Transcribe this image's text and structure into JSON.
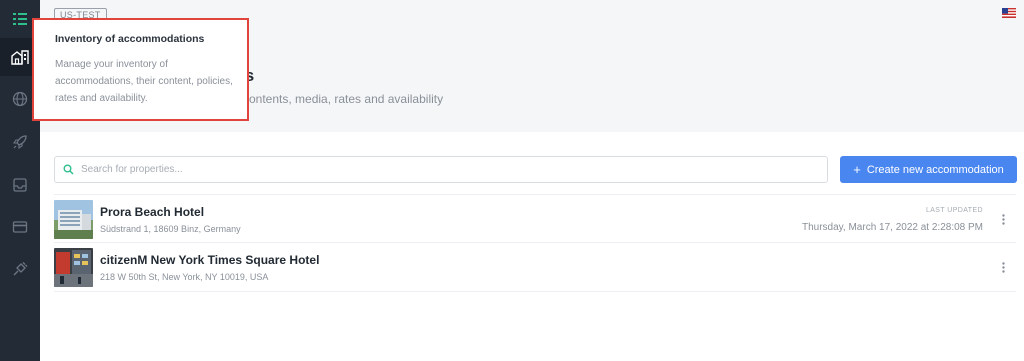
{
  "app": {
    "env_badge": "US-TEST",
    "locale_flag": "us-flag-icon"
  },
  "sidebar": {
    "items": [
      {
        "name": "menu",
        "icon": "menu-icon"
      },
      {
        "name": "accommodations",
        "icon": "hotel-building-icon",
        "active": true
      },
      {
        "name": "distribution",
        "icon": "globe-icon"
      },
      {
        "name": "launch",
        "icon": "rocket-icon"
      },
      {
        "name": "inbox",
        "icon": "inbox-icon"
      },
      {
        "name": "billing",
        "icon": "credit-card-icon"
      },
      {
        "name": "integrations",
        "icon": "plug-icon"
      }
    ]
  },
  "header": {
    "title": "ons",
    "subtitle": "ontents, media, rates and availability"
  },
  "tooltip": {
    "title": "Inventory of accommodations",
    "body": "Manage your inventory of accommodations, their content, policies, rates and availability."
  },
  "search": {
    "placeholder": "Search for properties..."
  },
  "actions": {
    "create_label": "Create new accommodation",
    "create_icon": "plus-icon"
  },
  "properties": [
    {
      "name": "Prora Beach Hotel",
      "address": "Südstrand 1, 18609 Binz, Germany",
      "last_updated_label": "LAST UPDATED",
      "last_updated": "Thursday, March 17, 2022 at 2:28:08 PM"
    },
    {
      "name": "citizenM New York Times Square Hotel",
      "address": "218 W 50th St, New York, NY 10019, USA",
      "last_updated_label": "",
      "last_updated": ""
    }
  ],
  "colors": {
    "sidebar_bg": "#232b36",
    "accent_green": "#2fbf8c",
    "primary_button": "#4a86f0",
    "highlight_border": "#e0443a"
  }
}
